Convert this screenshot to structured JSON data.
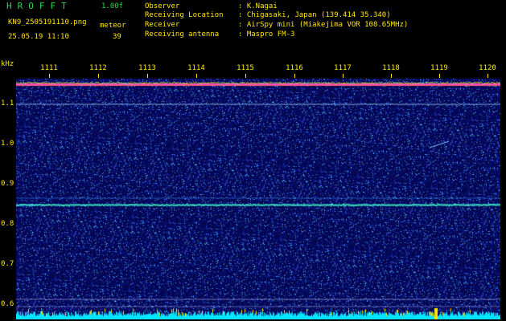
{
  "header": {
    "app_title": "HROFFT",
    "version": "1.00f",
    "filename": "KN9_2505191110.png",
    "meteor_label": "meteor",
    "timestamp": "25.05.19 11:10",
    "meteor_count": "39"
  },
  "station_info": [
    {
      "key": "Observer",
      "value": ": K.Nagai"
    },
    {
      "key": "Receiving Location",
      "value": ": Chigasaki, Japan (139.414 35.340)"
    },
    {
      "key": "Receiver",
      "value": ": AirSpy mini (Miakejima VOR 108.65MHz)"
    },
    {
      "key": "Receiving antenna",
      "value": ": Maspro FM-3"
    }
  ],
  "axis": {
    "unit": "kHz",
    "time_ticks": [
      "1111",
      "1112",
      "1113",
      "1114",
      "1115",
      "1116",
      "1117",
      "1118",
      "1119",
      "1120"
    ],
    "freq_ticks": [
      "1.1",
      "1.0",
      "0.9",
      "0.8",
      "0.7",
      "0.6"
    ]
  },
  "colors": {
    "label": "#ffe600",
    "title": "#29d64a",
    "background_noise": "#0a0f8a",
    "carrier_line": "#ff40c0",
    "bottom_noise": "#00e5ff"
  },
  "signals": {
    "carrier_freq_khz": 1.148,
    "line_1_freq_khz": 1.098,
    "line_2_freq_khz": 0.847,
    "line_3_freq_khz": 0.864,
    "low_line_freq_khz": 0.612,
    "low_line_2_freq_khz": 0.594,
    "meteor_streak_khz": 1.002
  }
}
